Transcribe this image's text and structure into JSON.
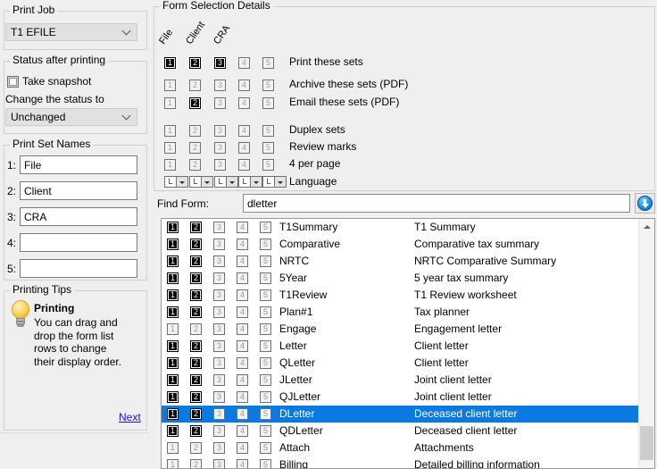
{
  "left": {
    "print_job": {
      "legend": "Print Job",
      "selected": "T1 EFILE"
    },
    "status_after_printing": {
      "legend": "Status after printing",
      "take_snapshot_label": "Take snapshot",
      "take_snapshot_checked": false,
      "change_status_label": "Change the status to",
      "status_selected": "Unchanged"
    },
    "print_set_names": {
      "legend": "Print Set Names",
      "rows": [
        {
          "num": "1:",
          "value": "File"
        },
        {
          "num": "2:",
          "value": "Client"
        },
        {
          "num": "3:",
          "value": "CRA"
        },
        {
          "num": "4:",
          "value": ""
        },
        {
          "num": "5:",
          "value": ""
        }
      ]
    },
    "printing_tips": {
      "legend": "Printing Tips",
      "title": "Printing",
      "text": "You can drag and drop the form list rows to change their display order.",
      "next_label": "Next"
    }
  },
  "right": {
    "legend": "Form Selection Details",
    "column_headers": [
      "File",
      "Client",
      "CRA"
    ],
    "set_numbers": [
      "1",
      "2",
      "3",
      "4",
      "5"
    ],
    "option_rows": [
      {
        "label": "Print these sets",
        "checked": [
          true,
          true,
          true,
          false,
          false
        ]
      },
      {
        "label": "Archive these sets (PDF)",
        "checked": [
          false,
          false,
          false,
          false,
          false
        ]
      },
      {
        "label": "Email these sets (PDF)",
        "checked": [
          false,
          true,
          false,
          false,
          false
        ]
      },
      {
        "label": "Duplex sets",
        "checked": [
          false,
          false,
          false,
          false,
          false
        ]
      },
      {
        "label": "Review marks",
        "checked": [
          false,
          false,
          false,
          false,
          false
        ]
      },
      {
        "label": "4 per page",
        "checked": [
          false,
          false,
          false,
          false,
          false
        ]
      }
    ],
    "language_row": {
      "label": "Language",
      "values": [
        "L",
        "L",
        "L",
        "L",
        "L"
      ]
    },
    "find_form": {
      "label": "Find Form:",
      "value": "dletter",
      "placeholder": "",
      "button_icon": "download-circle-icon"
    },
    "list": {
      "rows": [
        {
          "name": "T1Summary",
          "desc": "T1 Summary",
          "checked": [
            true,
            true,
            false,
            false,
            false
          ],
          "selected": false
        },
        {
          "name": "Comparative",
          "desc": "Comparative tax summary",
          "checked": [
            true,
            true,
            false,
            false,
            false
          ],
          "selected": false
        },
        {
          "name": "NRTC",
          "desc": "NRTC Comparative Summary",
          "checked": [
            true,
            true,
            false,
            false,
            false
          ],
          "selected": false
        },
        {
          "name": "5Year",
          "desc": "5 year tax summary",
          "checked": [
            true,
            true,
            false,
            false,
            false
          ],
          "selected": false
        },
        {
          "name": "T1Review",
          "desc": "T1 Review worksheet",
          "checked": [
            true,
            true,
            false,
            false,
            false
          ],
          "selected": false
        },
        {
          "name": "Plan#1",
          "desc": "Tax planner",
          "checked": [
            true,
            true,
            false,
            false,
            false
          ],
          "selected": false
        },
        {
          "name": "Engage",
          "desc": "Engagement letter",
          "checked": [
            false,
            false,
            false,
            false,
            false
          ],
          "selected": false
        },
        {
          "name": "Letter",
          "desc": "Client letter",
          "checked": [
            true,
            true,
            false,
            false,
            false
          ],
          "selected": false
        },
        {
          "name": "QLetter",
          "desc": "Client letter",
          "checked": [
            true,
            true,
            false,
            false,
            false
          ],
          "selected": false
        },
        {
          "name": "JLetter",
          "desc": "Joint client letter",
          "checked": [
            true,
            true,
            false,
            false,
            false
          ],
          "selected": false
        },
        {
          "name": "QJLetter",
          "desc": "Joint client letter",
          "checked": [
            true,
            true,
            false,
            false,
            false
          ],
          "selected": false
        },
        {
          "name": "DLetter",
          "desc": "Deceased client letter",
          "checked": [
            true,
            true,
            false,
            false,
            false
          ],
          "selected": true
        },
        {
          "name": "QDLetter",
          "desc": "Deceased client letter",
          "checked": [
            true,
            true,
            false,
            false,
            false
          ],
          "selected": false
        },
        {
          "name": "Attach",
          "desc": "Attachments",
          "checked": [
            false,
            false,
            false,
            false,
            false
          ],
          "selected": false
        },
        {
          "name": "Billing",
          "desc": "Detailed billing information",
          "checked": [
            false,
            false,
            false,
            false,
            false
          ],
          "selected": false
        }
      ]
    }
  },
  "colors": {
    "selection_blue": "#0a7ae0",
    "link_blue": "#1414d2",
    "panel_gray": "#efefef",
    "checked_box": "#000000"
  }
}
